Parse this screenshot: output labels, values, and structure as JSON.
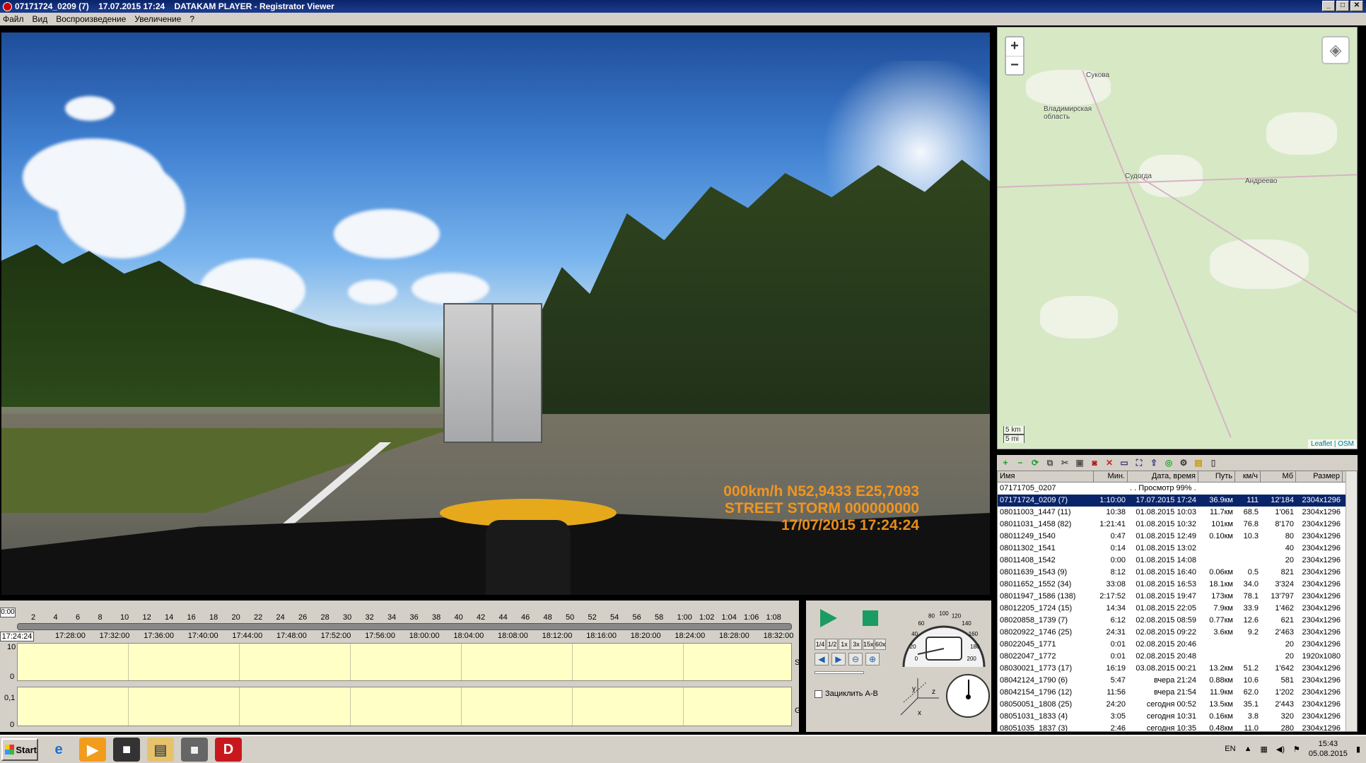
{
  "window": {
    "title": "07171724_0209 (7)    17.07.2015 17:24    DATAKAM PLAYER - Registrator Viewer",
    "min": "_",
    "max": "□",
    "close": "✕"
  },
  "menu": [
    "Файл",
    "Вид",
    "Воспроизведение",
    "Увеличение",
    "?"
  ],
  "video": {
    "osd_line1": "000km/h N52,9433 E25,7093",
    "osd_line2": "STREET STORM 000000000",
    "osd_line3": "17/07/2015 17:24:24"
  },
  "map": {
    "zoom_in": "+",
    "zoom_out": "−",
    "labels": {
      "region": "Владимирская\nобласть",
      "city1": "Судогда",
      "city2": "Андреево",
      "city3": "Сукова"
    },
    "scale_km": "5 km",
    "scale_mi": "5 mi",
    "attribution": "Leaflet | OSM"
  },
  "filelist": {
    "columns": [
      "Имя",
      "Мин.",
      "Дата, время",
      "Путь",
      "км/ч",
      "Мб",
      "Размер"
    ],
    "rows": [
      [
        "07171705_0207",
        "",
        ". . Просмотр 99% . . .",
        "",
        "",
        "",
        ""
      ],
      [
        "07171724_0209 (7)",
        "1:10:00",
        "17.07.2015 17:24",
        "36.9км",
        "111",
        "12'184",
        "2304x1296"
      ],
      [
        "08011003_1447 (11)",
        "10:38",
        "01.08.2015 10:03",
        "11.7км",
        "68.5",
        "1'061",
        "2304x1296"
      ],
      [
        "08011031_1458 (82)",
        "1:21:41",
        "01.08.2015 10:32",
        "101км",
        "76.8",
        "8'170",
        "2304x1296"
      ],
      [
        "08011249_1540",
        "0:47",
        "01.08.2015 12:49",
        "0.10км",
        "10.3",
        "80",
        "2304x1296"
      ],
      [
        "08011302_1541",
        "0:14",
        "01.08.2015 13:02",
        "",
        "",
        "40",
        "2304x1296"
      ],
      [
        "08011408_1542",
        "0:00",
        "01.08.2015 14:08",
        "",
        "",
        "20",
        "2304x1296"
      ],
      [
        "08011639_1543 (9)",
        "8:12",
        "01.08.2015 16:40",
        "0.06км",
        "0.5",
        "821",
        "2304x1296"
      ],
      [
        "08011652_1552 (34)",
        "33:08",
        "01.08.2015 16:53",
        "18.1км",
        "34.0",
        "3'324",
        "2304x1296"
      ],
      [
        "08011947_1586 (138)",
        "2:17:52",
        "01.08.2015 19:47",
        "173км",
        "78.1",
        "13'797",
        "2304x1296"
      ],
      [
        "08012205_1724 (15)",
        "14:34",
        "01.08.2015 22:05",
        "7.9км",
        "33.9",
        "1'462",
        "2304x1296"
      ],
      [
        "08020858_1739 (7)",
        "6:12",
        "02.08.2015 08:59",
        "0.77км",
        "12.6",
        "621",
        "2304x1296"
      ],
      [
        "08020922_1746 (25)",
        "24:31",
        "02.08.2015 09:22",
        "3.6км",
        "9.2",
        "2'463",
        "2304x1296"
      ],
      [
        "08022045_1771",
        "0:01",
        "02.08.2015 20:46",
        "",
        "",
        "20",
        "2304x1296"
      ],
      [
        "08022047_1772",
        "0:01",
        "02.08.2015 20:48",
        "",
        "",
        "20",
        "1920x1080"
      ],
      [
        "08030021_1773 (17)",
        "16:19",
        "03.08.2015 00:21",
        "13.2км",
        "51.2",
        "1'642",
        "2304x1296"
      ],
      [
        "08042124_1790 (6)",
        "5:47",
        "вчера 21:24",
        "0.88км",
        "10.6",
        "581",
        "2304x1296"
      ],
      [
        "08042154_1796 (12)",
        "11:56",
        "вчера 21:54",
        "11.9км",
        "62.0",
        "1'202",
        "2304x1296"
      ],
      [
        "08050051_1808 (25)",
        "24:20",
        "сегодня 00:52",
        "13.5км",
        "35.1",
        "2'443",
        "2304x1296"
      ],
      [
        "08051031_1833 (4)",
        "3:05",
        "сегодня 10:31",
        "0.16км",
        "3.8",
        "320",
        "2304x1296"
      ],
      [
        "08051035_1837 (3)",
        "2:46",
        "сегодня 10:35",
        "0.48км",
        "11.0",
        "280",
        "2304x1296"
      ]
    ]
  },
  "timeline": {
    "position": "0:00",
    "minute_ticks": [
      "2",
      "4",
      "6",
      "8",
      "10",
      "12",
      "14",
      "16",
      "18",
      "20",
      "22",
      "24",
      "26",
      "28",
      "30",
      "32",
      "34",
      "36",
      "38",
      "40",
      "42",
      "44",
      "46",
      "48",
      "50",
      "52",
      "54",
      "56",
      "58",
      "1:00",
      "1:02",
      "1:04",
      "1:06",
      "1:08"
    ],
    "current_time": "17:24:24",
    "clock_ticks": [
      "17:28:00",
      "17:32:00",
      "17:36:00",
      "17:40:00",
      "17:44:00",
      "17:48:00",
      "17:52:00",
      "17:56:00",
      "18:00:00",
      "18:04:00",
      "18:08:00",
      "18:12:00",
      "18:16:00",
      "18:20:00",
      "18:24:00",
      "18:28:00",
      "18:32:00"
    ],
    "graph1_max": "10",
    "graph1_min": "0",
    "graph1_tag": "S",
    "graph2_max": "0,1",
    "graph2_min": "0",
    "graph2_tag": "G"
  },
  "controls": {
    "speeds": [
      "1/4",
      "1/2",
      "1x",
      "3x",
      "15x",
      "60x"
    ],
    "loop_label": "Зациклить A-B"
  },
  "speedometer": {
    "ticks": [
      "0",
      "20",
      "40",
      "60",
      "80",
      "100",
      "120",
      "140",
      "160",
      "180",
      "200"
    ]
  },
  "axes": {
    "x": "x",
    "y": "y",
    "z": "z"
  },
  "taskbar": {
    "start": "Start",
    "lang": "EN",
    "time": "15:43",
    "date": "05.08.2015"
  }
}
